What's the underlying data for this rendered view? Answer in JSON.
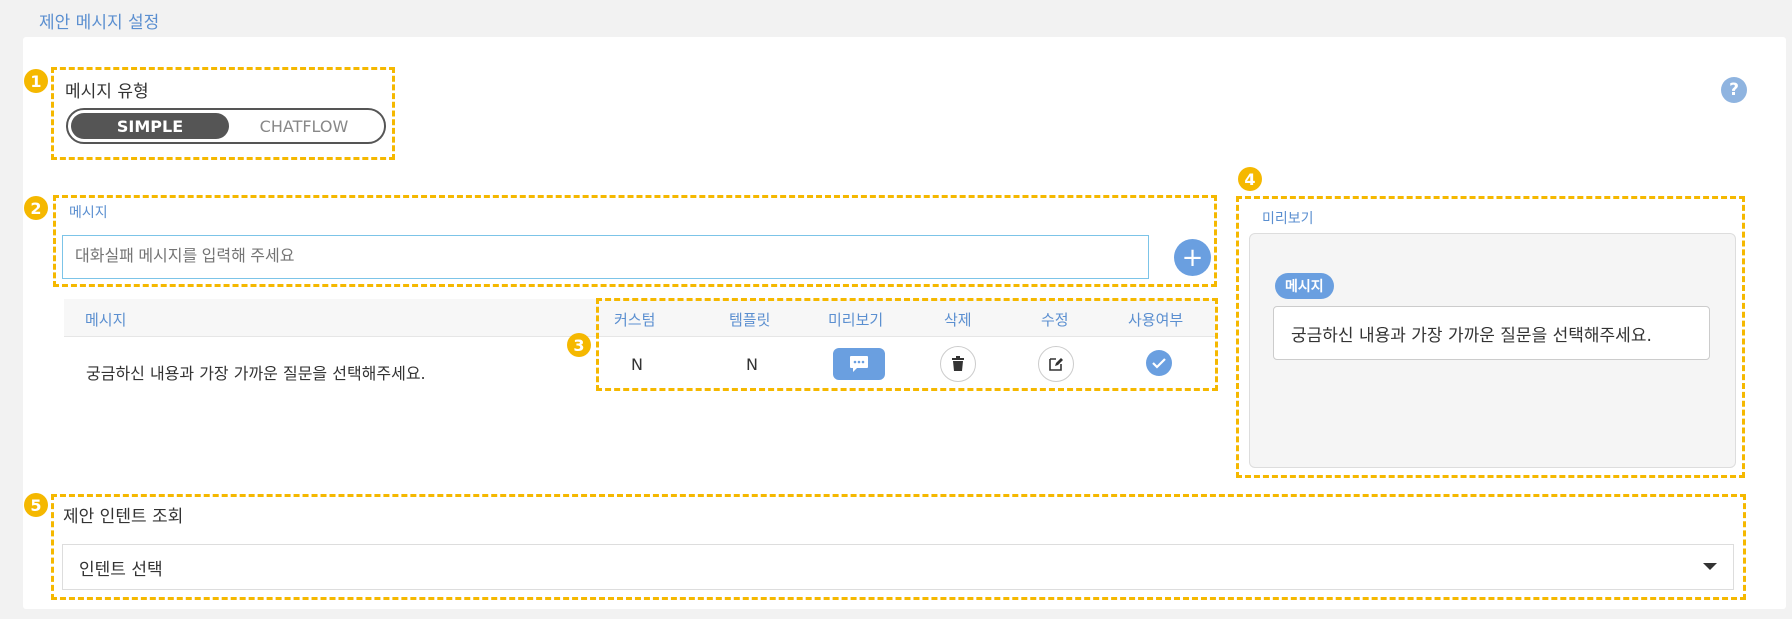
{
  "page_title": "제안 메시지 설정",
  "help_icon_glyph": "?",
  "annotations": [
    "1",
    "2",
    "3",
    "4",
    "5"
  ],
  "message_type": {
    "label": "메시지 유형",
    "options": [
      "SIMPLE",
      "CHATFLOW"
    ],
    "selected": "SIMPLE"
  },
  "message_input": {
    "label": "메시지",
    "value": "",
    "placeholder": "대화실패 메시지를 입력해 주세요",
    "add_glyph": "+"
  },
  "table": {
    "headers": {
      "message": "메시지",
      "custom": "커스텀",
      "template": "템플릿",
      "preview": "미리보기",
      "delete": "삭제",
      "edit": "수정",
      "enabled": "사용여부"
    },
    "rows": [
      {
        "message": "궁금하신 내용과 가장 가까운 질문을 선택해주세요.",
        "custom": "N",
        "template": "N",
        "enabled": true
      }
    ]
  },
  "preview": {
    "label": "미리보기",
    "pill": "메시지",
    "text": "궁금하신 내용과 가장 가까운 질문을 선택해주세요."
  },
  "intent": {
    "label": "제안 인텐트 조회",
    "selected": "인텐트 선택"
  },
  "colors": {
    "accent": "#6a9fe0",
    "annotation": "#f5b800",
    "label_blue": "#5b8fd0"
  }
}
